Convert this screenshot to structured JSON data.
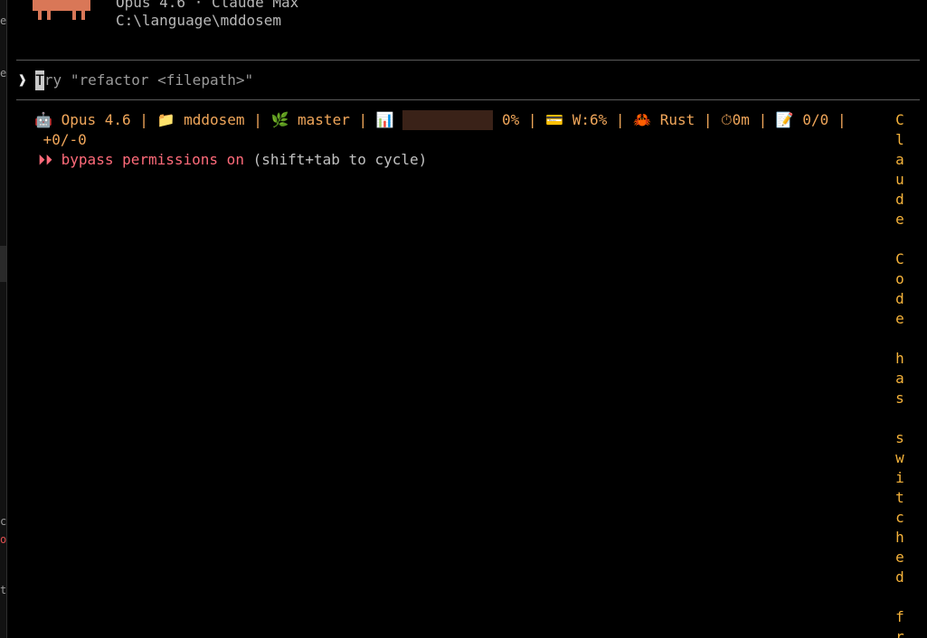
{
  "sidebar_fragments": [
    "es",
    "ec",
    "c",
    "o",
    "t"
  ],
  "header": {
    "model_line": "Opus 4.6 · Claude Max",
    "path_line": "C:\\language\\mddosem"
  },
  "prompt": {
    "arrow": "❱",
    "cursor_char": "T",
    "placeholder_rest": "ry \"refactor <filepath>\""
  },
  "status": {
    "robot_icon": "🤖",
    "model": "Opus 4.6",
    "folder_icon": "📁",
    "folder": "mddosem",
    "branch_icon": "🌿",
    "branch": "master",
    "chart_icon": "📊",
    "context_percent": "0%",
    "context_fraction": 0,
    "card_icon": "💳",
    "weekly": "W:6%",
    "crab_icon": "🦀",
    "language": "Rust",
    "timer_icon": "⏱",
    "elapsed": "0m",
    "memo_icon": "📝",
    "tasks": "0/0",
    "diff": "+0/-0",
    "separator": "|"
  },
  "permissions": {
    "icon": "⏵⏵",
    "text": "bypass permissions on",
    "hint": "(shift+tab to cycle)"
  },
  "vertical_notice": "Claude Code has switched fr",
  "colors": {
    "status_orange": "#f0a65a",
    "permission_red": "#ff6b7a",
    "notice_yellow": "#f5b23a",
    "mascot": "#d97757"
  }
}
